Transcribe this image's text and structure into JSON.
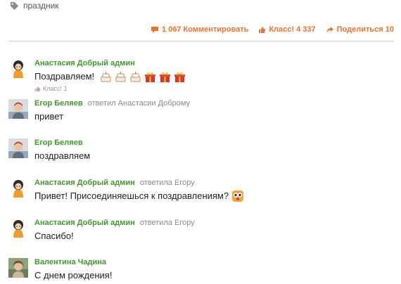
{
  "tag": {
    "label": "праздник"
  },
  "actions": {
    "comment": {
      "count": "1 067",
      "label": "Комментировать"
    },
    "klass": {
      "label": "Класс!",
      "count": "4 337"
    },
    "share": {
      "label": "Поделиться",
      "count": "10"
    }
  },
  "colors": {
    "accent": "#eb722e",
    "author": "#41962e",
    "muted": "#8a8a8a"
  },
  "comments": [
    {
      "author": "Анастасия Добрый админ",
      "reply_to": "",
      "text": "Поздравляем!",
      "avatar": "admin-avatar",
      "emoticons": [
        "cake-icon",
        "cake-icon",
        "cake-icon",
        "gift-icon",
        "gift-icon",
        "gift-icon"
      ],
      "klass": "Класс! 1"
    },
    {
      "author": "Егор Беляев",
      "reply_to": "ответил Анастасии Доброму",
      "text": "привет",
      "avatar": "user-photo-avatar"
    },
    {
      "author": "Егор Беляев",
      "reply_to": "",
      "text": "поздравляем",
      "avatar": "user-photo-avatar"
    },
    {
      "author": "Анастасия Добрый админ",
      "reply_to": "ответила Егору",
      "text": "Привет! Присоединяешься к поздравлениям?",
      "avatar": "admin-avatar",
      "emoticons": [
        "owl-smiley-icon"
      ]
    },
    {
      "author": "Анастасия Добрый админ",
      "reply_to": "ответила Егору",
      "text": "Спасибо!",
      "avatar": "admin-avatar"
    },
    {
      "author": "Валентина Чадина",
      "reply_to": "",
      "text": "С днем рождения!",
      "avatar": "user-photo-avatar"
    }
  ]
}
